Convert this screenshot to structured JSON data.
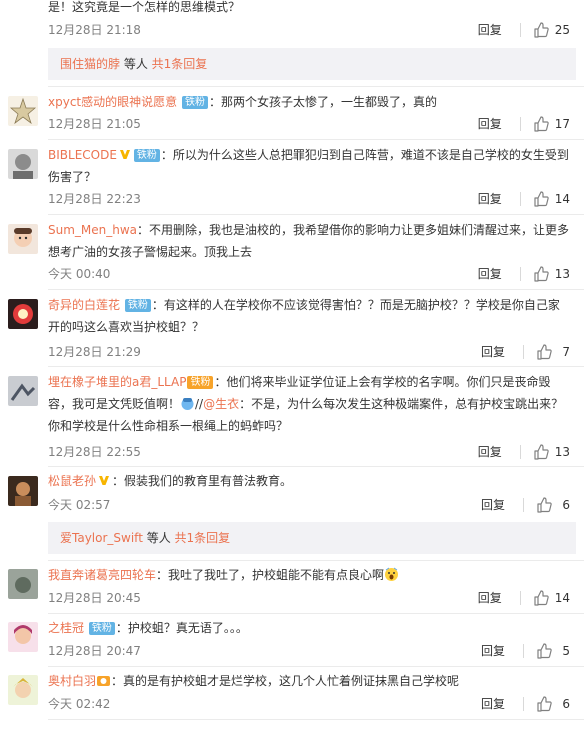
{
  "comments": [
    {
      "user": "",
      "text": "是！这究竟是一个怎样的思维模式？",
      "time": "12月28日 21:18",
      "reply": "回复",
      "likes": "25"
    },
    {
      "user": "xpyct感动的眼神说愿意",
      "badge": "铁粉",
      "text": "：那两个女孩子太惨了，一生都毁了，真的",
      "time": "12月28日 21:05",
      "reply": "回复",
      "likes": "17"
    },
    {
      "user": "BIBLECODE",
      "badge": "铁粉",
      "text": "：所以为什么这些人总把罪犯归到自己阵营，难道不该是自己学校的女生受到伤害了？",
      "time": "12月28日 22:23",
      "reply": "回复",
      "likes": "14"
    },
    {
      "user": "Sum_Men_hwa",
      "text": "：不用删除，我也是油校的，我希望借你的影响力让更多姐妹们清醒过来，让更多想考广油的女孩子警惕起来。顶我上去",
      "time": "今天 00:40",
      "reply": "回复",
      "likes": "13"
    },
    {
      "user": "奇异的白莲花",
      "badge": "铁粉",
      "text": "：有这样的人在学校你不应该觉得害怕？？而是无脑护校？？学校是你自己家开的吗这么喜欢当护校蛆？？",
      "time": "12月28日 21:29",
      "reply": "回复",
      "likes": "7"
    },
    {
      "user": "埋在橡子堆里的a君_LLAP",
      "badge": "铁粉",
      "text1": "：他们将来毕业证学位证上会有学校的名字啊。你们只是丧命毁容，我可是文凭贬值啊！",
      "mention": "@生衣",
      "text2": "：不是，为什么每次发生这种极端案件，总有护校宝跳出来？你和学校是什么性命相系一根绳上的蚂蚱吗？",
      "time": "12月28日 22:55",
      "reply": "回复",
      "likes": "13"
    },
    {
      "user": "松鼠老孙",
      "text": "：假装我们的教育里有普法教育。",
      "time": "今天 02:57",
      "reply": "回复",
      "likes": "6"
    },
    {
      "user": "我直奔诸葛亮四轮车",
      "text": "：我吐了我吐了，护校蛆能不能有点良心啊",
      "time": "12月28日 20:45",
      "reply": "回复",
      "likes": "14"
    },
    {
      "user": "之桂冠",
      "badge": "铁粉",
      "text": "：护校蛆？真无语了。。。",
      "time": "12月28日 20:47",
      "reply": "回复",
      "likes": "5"
    },
    {
      "user": "奥村白羽",
      "text": "：真的是有护校蛆才是烂学校，这几个人忙着例证抹黑自己学校呢",
      "time": "今天 02:42",
      "reply": "回复",
      "likes": "6"
    }
  ],
  "subreplies": [
    {
      "who": "围住猫的脖",
      "etc": " 等人 ",
      "more": "共1条回复"
    },
    {
      "who": "爱Taylor_Swift",
      "etc": " 等人 ",
      "more": "共1条回复"
    }
  ],
  "icons": {
    "like": "thumbs-up-icon",
    "vip": "v-verified-icon",
    "face": "scream-face-icon"
  },
  "colors": {
    "username": "#eb7350",
    "badge": "#62b3e4",
    "meta": "#808080",
    "subbox": "#f2f2f5"
  }
}
